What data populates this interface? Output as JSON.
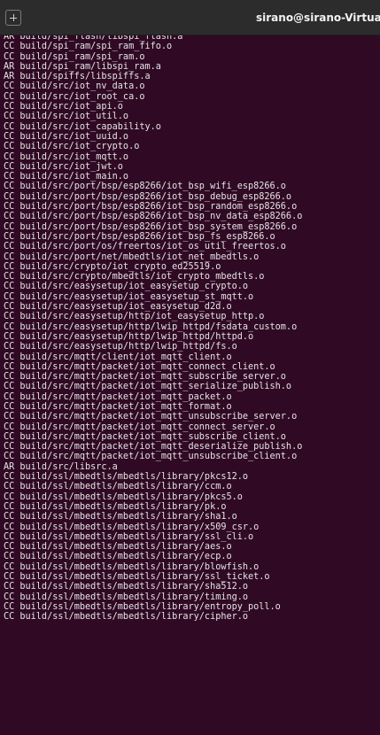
{
  "window": {
    "title": "sirano@sirano-Virtua"
  },
  "terminal": {
    "lines": [
      "AR build/spi_flash/libspi_flash.a",
      "CC build/spi_ram/spi_ram_fifo.o",
      "CC build/spi_ram/spi_ram.o",
      "AR build/spi_ram/libspi_ram.a",
      "AR build/spiffs/libspiffs.a",
      "CC build/src/iot_nv_data.o",
      "CC build/src/iot_root_ca.o",
      "CC build/src/iot_api.o",
      "CC build/src/iot_util.o",
      "CC build/src/iot_capability.o",
      "CC build/src/iot_uuid.o",
      "CC build/src/iot_crypto.o",
      "CC build/src/iot_mqtt.o",
      "CC build/src/iot_jwt.o",
      "CC build/src/iot_main.o",
      "CC build/src/port/bsp/esp8266/iot_bsp_wifi_esp8266.o",
      "CC build/src/port/bsp/esp8266/iot_bsp_debug_esp8266.o",
      "CC build/src/port/bsp/esp8266/iot_bsp_random_esp8266.o",
      "CC build/src/port/bsp/esp8266/iot_bsp_nv_data_esp8266.o",
      "CC build/src/port/bsp/esp8266/iot_bsp_system_esp8266.o",
      "CC build/src/port/bsp/esp8266/iot_bsp_fs_esp8266.o",
      "CC build/src/port/os/freertos/iot_os_util_freertos.o",
      "CC build/src/port/net/mbedtls/iot_net_mbedtls.o",
      "CC build/src/crypto/iot_crypto_ed25519.o",
      "CC build/src/crypto/mbedtls/iot_crypto_mbedtls.o",
      "CC build/src/easysetup/iot_easysetup_crypto.o",
      "CC build/src/easysetup/iot_easysetup_st_mqtt.o",
      "CC build/src/easysetup/iot_easysetup_d2d.o",
      "CC build/src/easysetup/http/iot_easysetup_http.o",
      "CC build/src/easysetup/http/lwip_httpd/fsdata_custom.o",
      "CC build/src/easysetup/http/lwip_httpd/httpd.o",
      "CC build/src/easysetup/http/lwip_httpd/fs.o",
      "CC build/src/mqtt/client/iot_mqtt_client.o",
      "CC build/src/mqtt/packet/iot_mqtt_connect_client.o",
      "CC build/src/mqtt/packet/iot_mqtt_subscribe_server.o",
      "CC build/src/mqtt/packet/iot_mqtt_serialize_publish.o",
      "CC build/src/mqtt/packet/iot_mqtt_packet.o",
      "CC build/src/mqtt/packet/iot_mqtt_format.o",
      "CC build/src/mqtt/packet/iot_mqtt_unsubscribe_server.o",
      "CC build/src/mqtt/packet/iot_mqtt_connect_server.o",
      "CC build/src/mqtt/packet/iot_mqtt_subscribe_client.o",
      "CC build/src/mqtt/packet/iot_mqtt_deserialize_publish.o",
      "CC build/src/mqtt/packet/iot_mqtt_unsubscribe_client.o",
      "AR build/src/libsrc.a",
      "CC build/ssl/mbedtls/mbedtls/library/pkcs12.o",
      "CC build/ssl/mbedtls/mbedtls/library/ccm.o",
      "CC build/ssl/mbedtls/mbedtls/library/pkcs5.o",
      "CC build/ssl/mbedtls/mbedtls/library/pk.o",
      "CC build/ssl/mbedtls/mbedtls/library/sha1.o",
      "CC build/ssl/mbedtls/mbedtls/library/x509_csr.o",
      "CC build/ssl/mbedtls/mbedtls/library/ssl_cli.o",
      "CC build/ssl/mbedtls/mbedtls/library/aes.o",
      "CC build/ssl/mbedtls/mbedtls/library/ecp.o",
      "CC build/ssl/mbedtls/mbedtls/library/blowfish.o",
      "CC build/ssl/mbedtls/mbedtls/library/ssl_ticket.o",
      "CC build/ssl/mbedtls/mbedtls/library/sha512.o",
      "CC build/ssl/mbedtls/mbedtls/library/timing.o",
      "CC build/ssl/mbedtls/mbedtls/library/entropy_poll.o",
      "CC build/ssl/mbedtls/mbedtls/library/cipher.o"
    ]
  },
  "colors": {
    "terminal_bg": "#300a24",
    "terminal_fg": "#e4e4e4",
    "titlebar_bg": "#2c2c2c",
    "title_fg": "#f2f2f2"
  },
  "icons": {
    "new_tab": "new-tab-icon"
  }
}
